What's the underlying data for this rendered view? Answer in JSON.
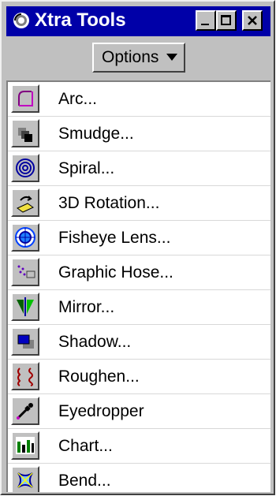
{
  "window": {
    "title": "Xtra Tools"
  },
  "toolbar": {
    "options_label": "Options"
  },
  "tools": [
    {
      "label": "Arc...",
      "icon": "arc-icon"
    },
    {
      "label": "Smudge...",
      "icon": "smudge-icon"
    },
    {
      "label": "Spiral...",
      "icon": "spiral-icon"
    },
    {
      "label": "3D Rotation...",
      "icon": "3d-rotation-icon"
    },
    {
      "label": "Fisheye Lens...",
      "icon": "fisheye-lens-icon"
    },
    {
      "label": "Graphic Hose...",
      "icon": "graphic-hose-icon"
    },
    {
      "label": "Mirror...",
      "icon": "mirror-icon"
    },
    {
      "label": "Shadow...",
      "icon": "shadow-icon"
    },
    {
      "label": "Roughen...",
      "icon": "roughen-icon"
    },
    {
      "label": "Eyedropper",
      "icon": "eyedropper-icon"
    },
    {
      "label": "Chart...",
      "icon": "chart-icon"
    },
    {
      "label": "Bend...",
      "icon": "bend-icon"
    }
  ]
}
